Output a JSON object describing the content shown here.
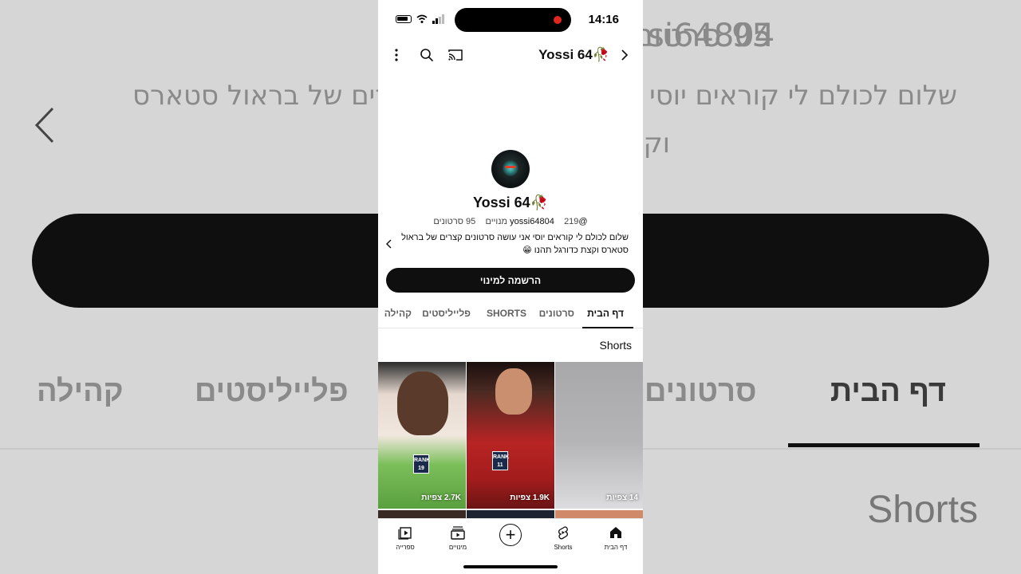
{
  "background": {
    "count_text": "95 סרטונים",
    "handle_fragment": "si64804",
    "desc_line1": "שלום לכולם לי קוראים יוסי אני עושה סרטונים קצרים של בראול סטארס",
    "desc_line2": "וקצת כדורגל",
    "tabs": [
      "דף הבית",
      "סרטונים",
      "פלייליסטים",
      "קהילה"
    ],
    "shorts_label": "Shorts"
  },
  "status_bar": {
    "time": "14:16"
  },
  "top_bar": {
    "channel_title": "Yossi 64🥀",
    "icons": [
      "back-chevron-icon",
      "cast-icon",
      "search-icon",
      "more-vert-icon"
    ]
  },
  "channel": {
    "name": "Yossi 64🥀",
    "handle": "@yossi64804",
    "subscribers": "219 מנויים",
    "videos": "95 סרטונים",
    "description": "שלום לכולם לי קוראים יוסי אני עושה סרטונים קצרים של בראול סטארס וקצת כדורגל תהנו 😁",
    "subscribe_label": "הרשמה למינוי"
  },
  "tabs": [
    {
      "label": "דף הבית",
      "active": true
    },
    {
      "label": "סרטונים",
      "active": false
    },
    {
      "label": "SHORTS",
      "active": false
    },
    {
      "label": "פלייליסטים",
      "active": false
    },
    {
      "label": "קהילה",
      "active": false
    }
  ],
  "shorts_section": {
    "title": "Shorts",
    "items": [
      {
        "views": "2.7K צפיות",
        "badge": "RANK 19"
      },
      {
        "views": "1.9K צפיות",
        "badge": "RANK 11"
      },
      {
        "views": "14 צפיות",
        "badge": ""
      }
    ]
  },
  "bottom_nav": [
    {
      "label": "ספרייה",
      "icon": "library-icon"
    },
    {
      "label": "מינויים",
      "icon": "subscriptions-icon"
    },
    {
      "label": "",
      "icon": "create-plus-icon"
    },
    {
      "label": "Shorts",
      "icon": "shorts-icon"
    },
    {
      "label": "דף הבית",
      "icon": "home-icon"
    }
  ],
  "colors": {
    "accent": "#0f0f0f",
    "recording_dot": "#e0281e"
  }
}
